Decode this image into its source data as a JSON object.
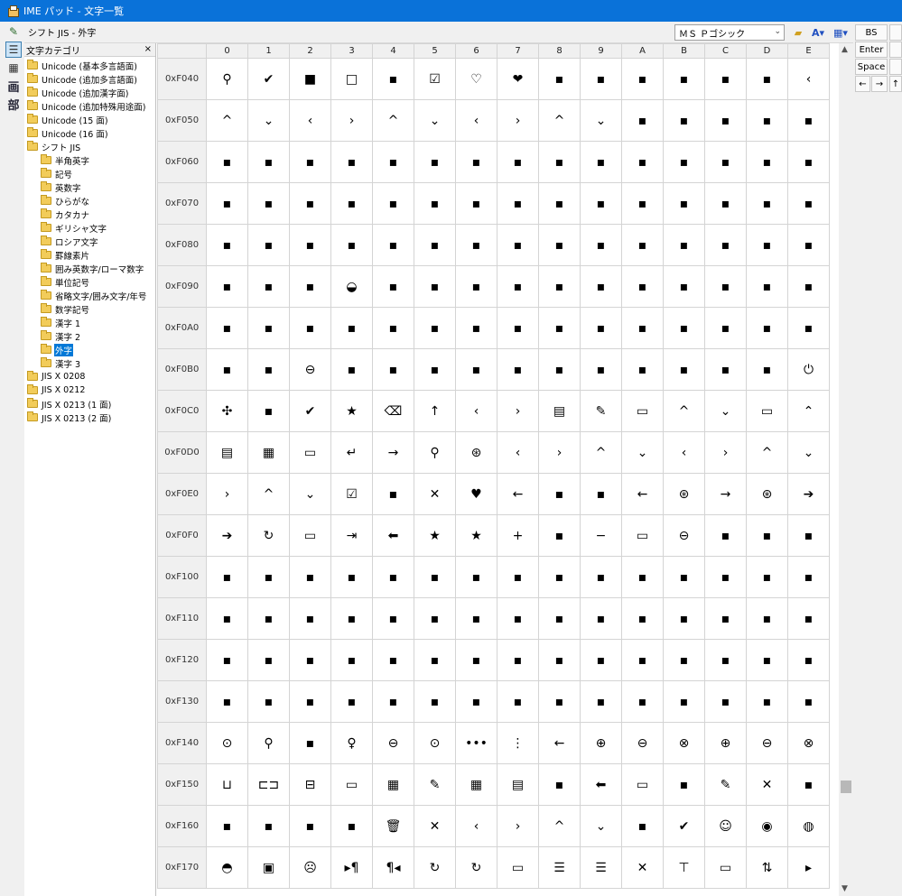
{
  "titlebar": {
    "title": "IME パッド - 文字一覧"
  },
  "header": {
    "path": "シフト JIS - 外字",
    "font_name": "ＭＳ Ｐゴシック"
  },
  "iconstrip": {
    "pen_glyph": "✎",
    "list_glyph": "☰",
    "kb_glyph": "▦",
    "kaku_glyph": "画",
    "bu_glyph": "部"
  },
  "category": {
    "title": "文字カテゴリ",
    "close": "×",
    "items": [
      {
        "label": "Unicode (基本多言語面)",
        "level": 1
      },
      {
        "label": "Unicode (追加多言語面)",
        "level": 1
      },
      {
        "label": "Unicode (追加漢字面)",
        "level": 1
      },
      {
        "label": "Unicode (追加特殊用途面)",
        "level": 1
      },
      {
        "label": "Unicode (15 面)",
        "level": 1
      },
      {
        "label": "Unicode (16 面)",
        "level": 1
      },
      {
        "label": "シフト JIS",
        "level": 1
      },
      {
        "label": "半角英字",
        "level": 2
      },
      {
        "label": "記号",
        "level": 2
      },
      {
        "label": "英数字",
        "level": 2
      },
      {
        "label": "ひらがな",
        "level": 2
      },
      {
        "label": "カタカナ",
        "level": 2
      },
      {
        "label": "ギリシャ文字",
        "level": 2
      },
      {
        "label": "ロシア文字",
        "level": 2
      },
      {
        "label": "罫線素片",
        "level": 2
      },
      {
        "label": "囲み英数字/ローマ数字",
        "level": 2
      },
      {
        "label": "単位記号",
        "level": 2
      },
      {
        "label": "省略文字/囲み文字/年号",
        "level": 2
      },
      {
        "label": "数学記号",
        "level": 2
      },
      {
        "label": "漢字 1",
        "level": 2
      },
      {
        "label": "漢字 2",
        "level": 2
      },
      {
        "label": "外字",
        "level": 2,
        "selected": true
      },
      {
        "label": "漢字 3",
        "level": 2
      },
      {
        "label": "JIS X 0208",
        "level": 1
      },
      {
        "label": "JIS X 0212",
        "level": 1
      },
      {
        "label": "JIS X 0213 (1 面)",
        "level": 1
      },
      {
        "label": "JIS X 0213 (2 面)",
        "level": 1
      }
    ]
  },
  "grid": {
    "columns": [
      "0",
      "1",
      "2",
      "3",
      "4",
      "5",
      "6",
      "7",
      "8",
      "9",
      "A",
      "B",
      "C",
      "D",
      "E"
    ],
    "rows": [
      {
        "code": "0xF040",
        "chars": [
          "⚲",
          "✔",
          "■",
          "□",
          "▪",
          "☑",
          "♡",
          "❤",
          "▪",
          "▪",
          "▪",
          "▪",
          "▪",
          "▪",
          "‹"
        ]
      },
      {
        "code": "0xF050",
        "chars": [
          "^",
          "⌄",
          "‹",
          "›",
          "^",
          "⌄",
          "‹",
          "›",
          "^",
          "⌄",
          "▪",
          "▪",
          "▪",
          "▪",
          "▪"
        ]
      },
      {
        "code": "0xF060",
        "chars": [
          "▪",
          "▪",
          "▪",
          "▪",
          "▪",
          "▪",
          "▪",
          "▪",
          "▪",
          "▪",
          "▪",
          "▪",
          "▪",
          "▪",
          "▪"
        ]
      },
      {
        "code": "0xF070",
        "chars": [
          "▪",
          "▪",
          "▪",
          "▪",
          "▪",
          "▪",
          "▪",
          "▪",
          "▪",
          "▪",
          "▪",
          "▪",
          "▪",
          "▪",
          "▪"
        ]
      },
      {
        "code": "0xF080",
        "chars": [
          "▪",
          "▪",
          "▪",
          "▪",
          "▪",
          "▪",
          "▪",
          "▪",
          "▪",
          "▪",
          "▪",
          "▪",
          "▪",
          "▪",
          "▪"
        ]
      },
      {
        "code": "0xF090",
        "chars": [
          "▪",
          "▪",
          "▪",
          "◒",
          "▪",
          "▪",
          "▪",
          "▪",
          "▪",
          "▪",
          "▪",
          "▪",
          "▪",
          "▪",
          "▪"
        ]
      },
      {
        "code": "0xF0A0",
        "chars": [
          "▪",
          "▪",
          "▪",
          "▪",
          "▪",
          "▪",
          "▪",
          "▪",
          "▪",
          "▪",
          "▪",
          "▪",
          "▪",
          "▪",
          "▪"
        ]
      },
      {
        "code": "0xF0B0",
        "chars": [
          "▪",
          "▪",
          "⊖",
          "▪",
          "▪",
          "▪",
          "▪",
          "▪",
          "▪",
          "▪",
          "▪",
          "▪",
          "▪",
          "▪",
          "⏻"
        ]
      },
      {
        "code": "0xF0C0",
        "chars": [
          "✣",
          "▪",
          "✔",
          "★",
          "⌫",
          "↑",
          "‹",
          "›",
          "▤",
          "✎",
          "▭",
          "^",
          "⌄",
          "▭",
          "⌃"
        ]
      },
      {
        "code": "0xF0D0",
        "chars": [
          "▤",
          "▦",
          "▭",
          "↵",
          "→",
          "⚲",
          "⊛",
          "‹",
          "›",
          "^",
          "⌄",
          "‹",
          "›",
          "^",
          "⌄"
        ]
      },
      {
        "code": "0xF0E0",
        "chars": [
          "›",
          "^",
          "⌄",
          "☑",
          "▪",
          "✕",
          "♥",
          "←",
          "▪",
          "▪",
          "←",
          "⊛",
          "→",
          "⊛",
          "➔"
        ]
      },
      {
        "code": "0xF0F0",
        "chars": [
          "➔",
          "↻",
          "▭",
          "⇥",
          "⬅",
          "★",
          "★",
          "+",
          "▪",
          "−",
          "▭",
          "⊖",
          "▪",
          "▪",
          "▪"
        ]
      },
      {
        "code": "0xF100",
        "chars": [
          "▪",
          "▪",
          "▪",
          "▪",
          "▪",
          "▪",
          "▪",
          "▪",
          "▪",
          "▪",
          "▪",
          "▪",
          "▪",
          "▪",
          "▪"
        ]
      },
      {
        "code": "0xF110",
        "chars": [
          "▪",
          "▪",
          "▪",
          "▪",
          "▪",
          "▪",
          "▪",
          "▪",
          "▪",
          "▪",
          "▪",
          "▪",
          "▪",
          "▪",
          "▪"
        ]
      },
      {
        "code": "0xF120",
        "chars": [
          "▪",
          "▪",
          "▪",
          "▪",
          "▪",
          "▪",
          "▪",
          "▪",
          "▪",
          "▪",
          "▪",
          "▪",
          "▪",
          "▪",
          "▪"
        ]
      },
      {
        "code": "0xF130",
        "chars": [
          "▪",
          "▪",
          "▪",
          "▪",
          "▪",
          "▪",
          "▪",
          "▪",
          "▪",
          "▪",
          "▪",
          "▪",
          "▪",
          "▪",
          "▪"
        ]
      },
      {
        "code": "0xF140",
        "chars": [
          "⊙",
          "⚲",
          "▪",
          "♀",
          "⊖",
          "⊙",
          "•••",
          "⋮",
          "←",
          "⊕",
          "⊖",
          "⊗",
          "⊕",
          "⊖",
          "⊗"
        ]
      },
      {
        "code": "0xF150",
        "chars": [
          "⊔",
          "⊏⊐",
          "⊟",
          "▭",
          "▦",
          "✎",
          "▦",
          "▤",
          "▪",
          "⬅",
          "▭",
          "▪",
          "✎",
          "✕",
          "▪"
        ]
      },
      {
        "code": "0xF160",
        "chars": [
          "▪",
          "▪",
          "▪",
          "▪",
          "🗑",
          "✕",
          "‹",
          "›",
          "^",
          "⌄",
          "▪",
          "✔",
          "☺",
          "◉",
          "◍"
        ]
      },
      {
        "code": "0xF170",
        "chars": [
          "◓",
          "▣",
          "☹",
          "▸¶",
          "¶◂",
          "↻",
          "↻",
          "▭",
          "☰",
          "☰",
          "✕",
          "⊤",
          "▭",
          "⇅",
          "▸"
        ]
      }
    ]
  },
  "keys": {
    "bs": "BS",
    "enter": "Enter",
    "space": "Space",
    "left": "←",
    "right": "→",
    "up": "↑"
  },
  "scroll": {
    "up": "▲",
    "down": "▼"
  }
}
